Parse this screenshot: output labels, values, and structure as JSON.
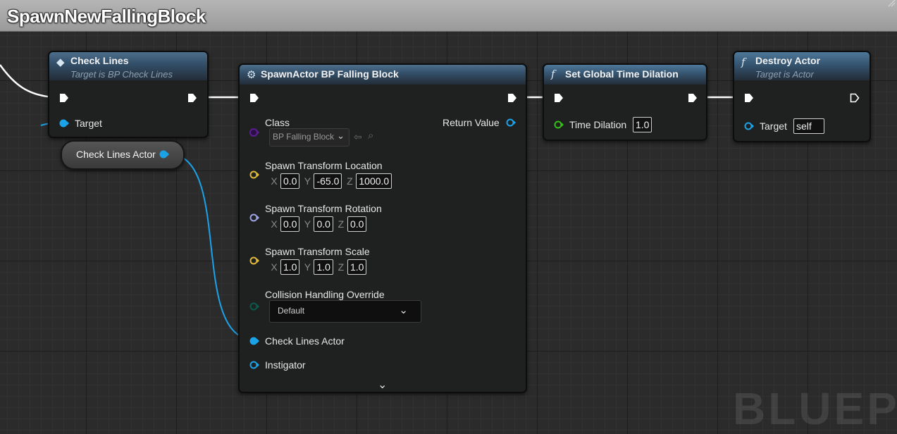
{
  "comment": {
    "title": "SpawnNewFallingBlock"
  },
  "check_lines": {
    "title": "Check Lines",
    "subtitle": "Target is BP Check Lines",
    "target_label": "Target"
  },
  "variable_getter": {
    "label": "Check Lines Actor"
  },
  "spawn_actor": {
    "title": "SpawnActor BP Falling Block",
    "class_label": "Class",
    "class_value": "BP Falling Block",
    "return_label": "Return Value",
    "location": {
      "label": "Spawn Transform Location",
      "x": "0.0",
      "y": "-65.0",
      "z": "1000.0"
    },
    "rotation": {
      "label": "Spawn Transform Rotation",
      "x": "0.0",
      "y": "0.0",
      "z": "0.0"
    },
    "scale": {
      "label": "Spawn Transform Scale",
      "x": "1.0",
      "y": "1.0",
      "z": "1.0"
    },
    "collision": {
      "label": "Collision Handling Override",
      "value": "Default"
    },
    "check_lines_actor_label": "Check Lines Actor",
    "instigator_label": "Instigator"
  },
  "time_dilation": {
    "title": "Set Global Time Dilation",
    "param_label": "Time Dilation",
    "param_value": "1.0"
  },
  "destroy_actor": {
    "title": "Destroy Actor",
    "subtitle": "Target is Actor",
    "target_label": "Target",
    "target_value": "self"
  },
  "axes": {
    "x": "X",
    "y": "Y",
    "z": "Z"
  },
  "watermark": "BLUEP",
  "colors": {
    "exec_wire": "#ffffff",
    "object_pin": "#1ba3ea",
    "class_pin": "#5b1d8f",
    "vector_pin": "#e3b93a",
    "rotator_pin": "#9ea4e6",
    "enum_pin": "#0a5b4b",
    "float_pin": "#34c016"
  },
  "icons": {
    "check_lines": "function-call-icon",
    "spawn_actor": "spawn-actor-icon",
    "time_dilation": "function-icon",
    "destroy_actor": "function-icon"
  }
}
